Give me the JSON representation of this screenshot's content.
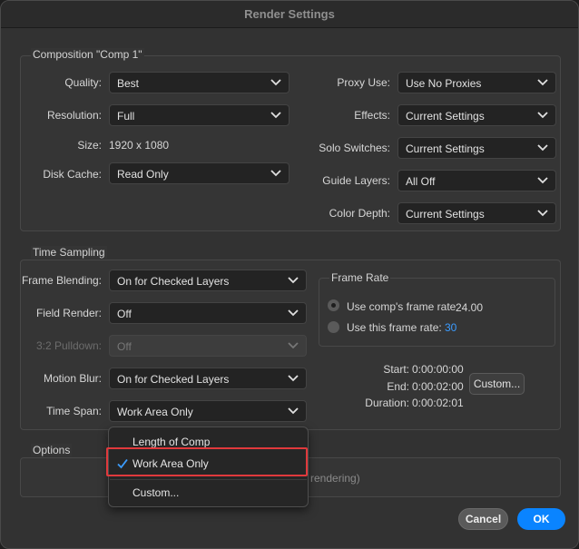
{
  "window": {
    "title": "Render Settings"
  },
  "composition": {
    "group_label": "Composition \"Comp 1\"",
    "quality": {
      "label": "Quality:",
      "value": "Best"
    },
    "resolution": {
      "label": "Resolution:",
      "value": "Full"
    },
    "size": {
      "label": "Size:",
      "value": "1920 x 1080"
    },
    "disk_cache": {
      "label": "Disk Cache:",
      "value": "Read Only"
    },
    "proxy_use": {
      "label": "Proxy Use:",
      "value": "Use No Proxies"
    },
    "effects": {
      "label": "Effects:",
      "value": "Current Settings"
    },
    "solo_switches": {
      "label": "Solo Switches:",
      "value": "Current Settings"
    },
    "guide_layers": {
      "label": "Guide Layers:",
      "value": "All Off"
    },
    "color_depth": {
      "label": "Color Depth:",
      "value": "Current Settings"
    }
  },
  "time_sampling": {
    "group_label": "Time Sampling",
    "frame_blending": {
      "label": "Frame Blending:",
      "value": "On for Checked Layers"
    },
    "field_render": {
      "label": "Field Render:",
      "value": "Off"
    },
    "pulldown": {
      "label": "3:2 Pulldown:",
      "value": "Off"
    },
    "motion_blur": {
      "label": "Motion Blur:",
      "value": "On for Checked Layers"
    },
    "time_span": {
      "label": "Time Span:",
      "value": "Work Area Only"
    },
    "frame_rate": {
      "group_label": "Frame Rate",
      "use_comp": {
        "label": "Use comp's frame rate",
        "value": "24.00",
        "selected": true
      },
      "use_this": {
        "label": "Use this frame rate:",
        "value": "30",
        "selected": false
      }
    },
    "start": {
      "label": "Start:",
      "value": "0:00:00:00"
    },
    "end": {
      "label": "End:",
      "value": "0:00:02:00"
    },
    "duration": {
      "label": "Duration:",
      "value": "0:00:02:01"
    },
    "custom_button": "Custom..."
  },
  "options": {
    "group_label": "Options",
    "partial_text": "rendering)"
  },
  "time_span_menu": {
    "items": [
      "Length of Comp",
      "Work Area Only",
      "Custom..."
    ],
    "selected": "Work Area Only"
  },
  "buttons": {
    "cancel": "Cancel",
    "ok": "OK"
  },
  "colors": {
    "accent": "#0a84ff",
    "highlight": "#e0393c",
    "link_value": "#3b9cff"
  }
}
